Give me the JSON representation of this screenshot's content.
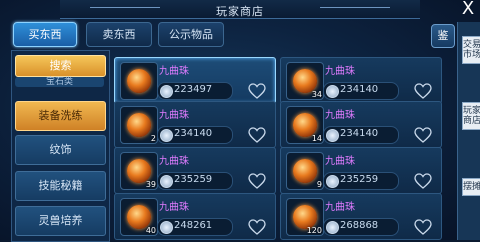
{
  "window": {
    "title": "玩家商店",
    "close_label": "X"
  },
  "tabs": [
    {
      "label": "买东西",
      "active": true
    },
    {
      "label": "卖东西",
      "active": false
    },
    {
      "label": "公示物品",
      "active": false
    }
  ],
  "right_button_label": "鉴",
  "side_panel": {
    "tabs": [
      "交易市场",
      "玩家商店",
      "摆摊"
    ]
  },
  "menu": {
    "search_label": "搜索",
    "partial_label": "宝石类",
    "items": [
      "装备洗练",
      "纹饰",
      "技能秘籍",
      "灵兽培养"
    ]
  },
  "colors": {
    "accent": "#2f8fd9",
    "item_name": "#e07bff",
    "highlight": "#f1b851"
  },
  "listings": [
    {
      "name": "九曲珠",
      "price": "223497",
      "qty": "",
      "selected": true,
      "icon": "fire-orb-icon"
    },
    {
      "name": "九曲珠",
      "price": "234140",
      "qty": "34",
      "selected": false,
      "icon": "fire-orb-icon"
    },
    {
      "name": "九曲珠",
      "price": "234140",
      "qty": "2",
      "selected": false,
      "icon": "fire-orb-icon"
    },
    {
      "name": "九曲珠",
      "price": "234140",
      "qty": "14",
      "selected": false,
      "icon": "fire-orb-icon"
    },
    {
      "name": "九曲珠",
      "price": "235259",
      "qty": "39",
      "selected": false,
      "icon": "fire-orb-icon"
    },
    {
      "name": "九曲珠",
      "price": "235259",
      "qty": "9",
      "selected": false,
      "icon": "fire-orb-icon"
    },
    {
      "name": "九曲珠",
      "price": "248261",
      "qty": "40",
      "selected": false,
      "icon": "fire-orb-icon"
    },
    {
      "name": "九曲珠",
      "price": "268868",
      "qty": "120",
      "selected": false,
      "icon": "fire-orb-icon"
    }
  ]
}
